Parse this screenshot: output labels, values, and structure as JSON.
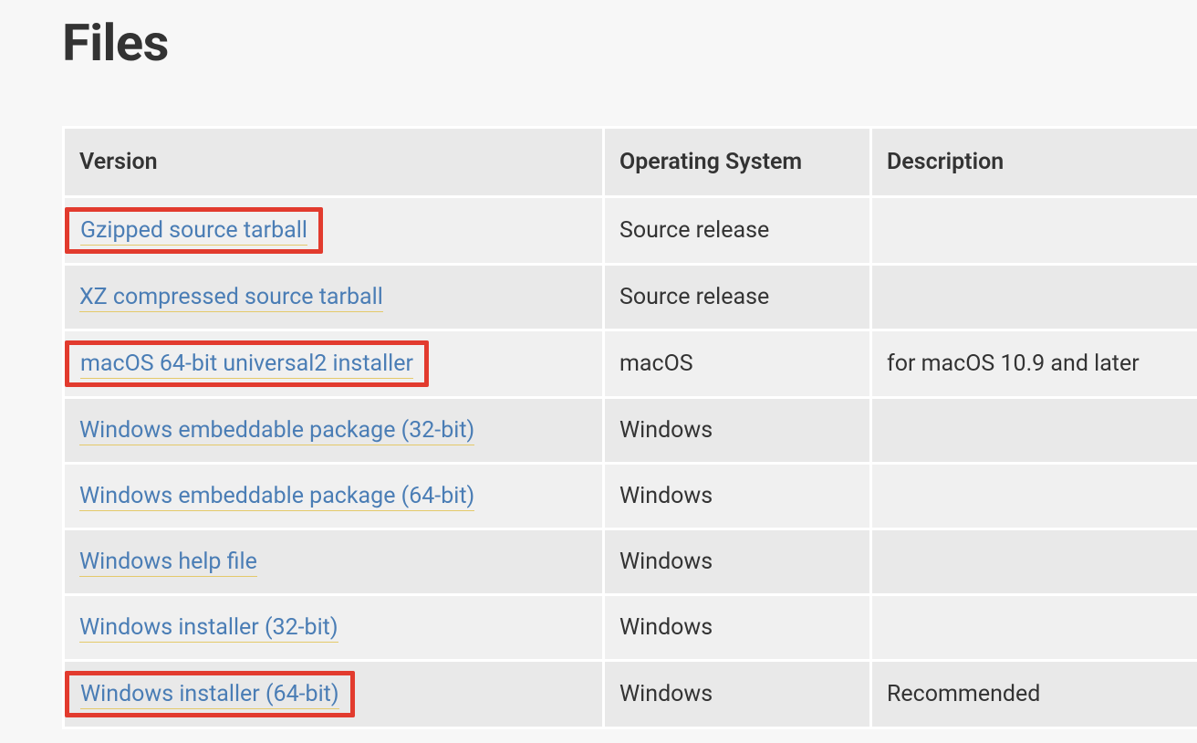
{
  "title": "Files",
  "columns": {
    "version": "Version",
    "os": "Operating System",
    "desc": "Description"
  },
  "rows": [
    {
      "version": "Gzipped source tarball",
      "os": "Source release",
      "desc": "",
      "highlight": true
    },
    {
      "version": "XZ compressed source tarball",
      "os": "Source release",
      "desc": "",
      "highlight": false
    },
    {
      "version": "macOS 64-bit universal2 installer",
      "os": "macOS",
      "desc": "for macOS 10.9 and later",
      "highlight": true
    },
    {
      "version": "Windows embeddable package (32-bit)",
      "os": "Windows",
      "desc": "",
      "highlight": false
    },
    {
      "version": "Windows embeddable package (64-bit)",
      "os": "Windows",
      "desc": "",
      "highlight": false
    },
    {
      "version": "Windows help file",
      "os": "Windows",
      "desc": "",
      "highlight": false
    },
    {
      "version": "Windows installer (32-bit)",
      "os": "Windows",
      "desc": "",
      "highlight": false
    },
    {
      "version": "Windows installer (64-bit)",
      "os": "Windows",
      "desc": "Recommended",
      "highlight": true
    }
  ]
}
